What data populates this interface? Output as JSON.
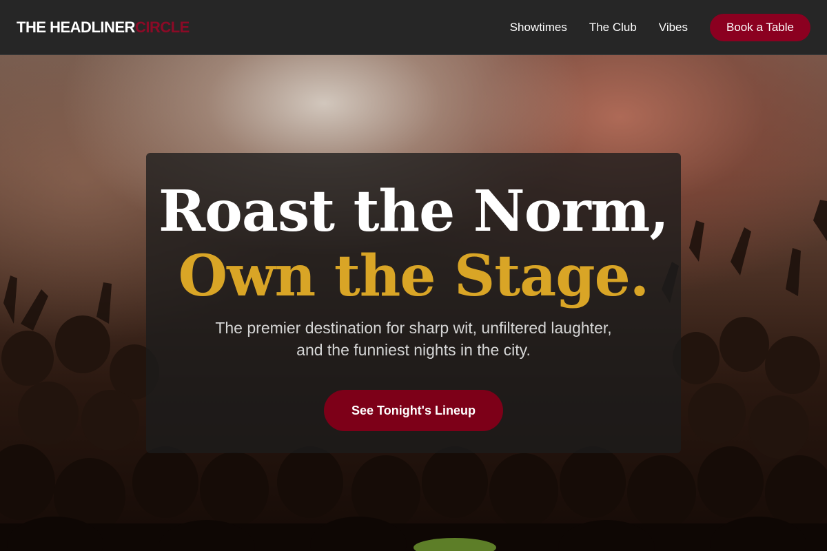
{
  "brand": {
    "name_main": "THE HEADLINER",
    "name_accent": "CIRCLE"
  },
  "nav": {
    "links": [
      "Showtimes",
      "The Club",
      "Vibes"
    ],
    "cta_label": "Book a Table"
  },
  "hero": {
    "headline_line1": "Roast the Norm,",
    "headline_line2": "Own the Stage.",
    "subtitle_line1": "The premier destination for sharp wit, unfiltered laughter,",
    "subtitle_line2": "and the funniest nights in the city.",
    "cta_label": "See Tonight's Lineup",
    "background_image": "concert-crowd-photo"
  },
  "colors": {
    "navbar_bg": "#262626",
    "brand_accent": "#8b0a26",
    "button_red": "#8b0020",
    "headline_gold": "#d9a526",
    "card_bg": "rgba(28,28,28,0.78)"
  }
}
